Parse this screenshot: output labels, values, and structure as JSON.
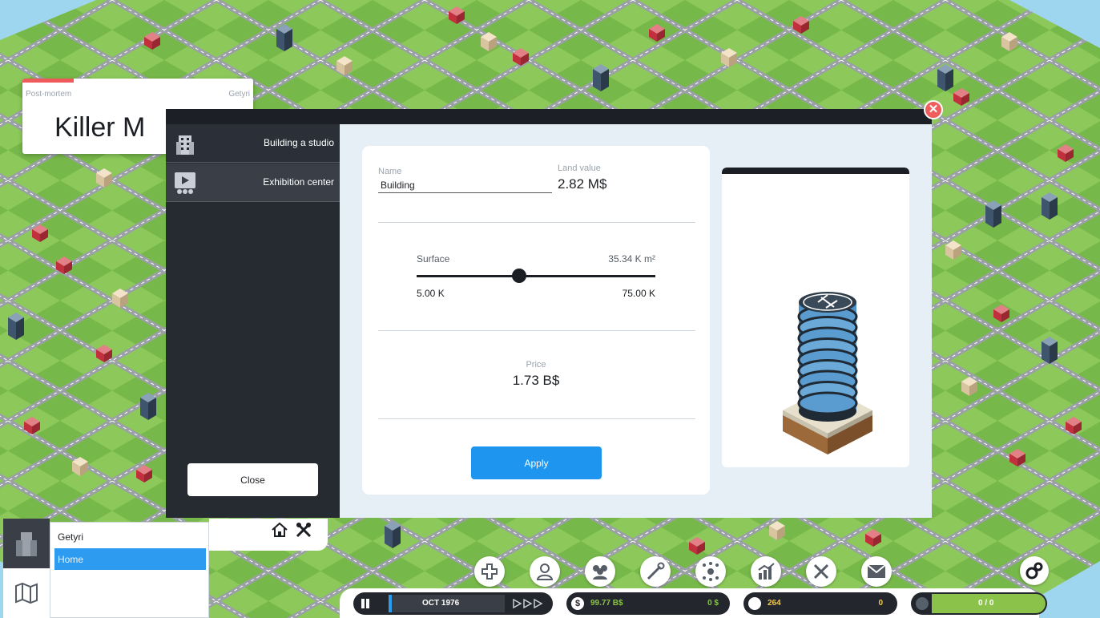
{
  "post_mortem": {
    "label": "Post-mortem",
    "owner": "Getyri",
    "game_title": "Killer M"
  },
  "modal": {
    "sidebar": {
      "items": [
        {
          "label": "Building a studio",
          "icon": "building-icon"
        },
        {
          "label": "Exhibition center",
          "icon": "exhibition-icon"
        }
      ],
      "close_label": "Close"
    },
    "form": {
      "name_label": "Name",
      "name_value": "Building",
      "land_value_label": "Land value",
      "land_value": "2.82 M$",
      "surface_label": "Surface",
      "surface_value": "35.34 K m²",
      "surface_min": "5.00 K",
      "surface_max": "75.00 K",
      "surface_slider_fraction": 0.43,
      "price_label": "Price",
      "price_value": "1.73 B$",
      "apply_label": "Apply"
    },
    "preview_icon": "skyscraper-helipad-icon",
    "close_icon": "close-icon"
  },
  "bottom_left": {
    "tabs": [
      "building-icon",
      "map-icon"
    ],
    "list": [
      "Getyri",
      "Home"
    ],
    "tool_icons": [
      "home-icon",
      "tools-icon"
    ]
  },
  "toolbar": {
    "round_buttons": [
      "add-icon",
      "person-icon",
      "team-icon",
      "wrench-icon",
      "network-icon",
      "chart-icon",
      "tools-cross-icon",
      "mail-icon"
    ],
    "date": "OCT 1976",
    "speed_icon": "fast-forward-icon",
    "money": "99.77 B$",
    "money_delta": "0 $",
    "fans": "264",
    "fans_delta": "0",
    "research": "0 / 0",
    "settings_icon": "gear-icon"
  },
  "colors": {
    "accent": "#1e95ee",
    "dark_panel": "#23262d",
    "close_red": "#ef5d5d",
    "money_green": "#8bc34a"
  }
}
